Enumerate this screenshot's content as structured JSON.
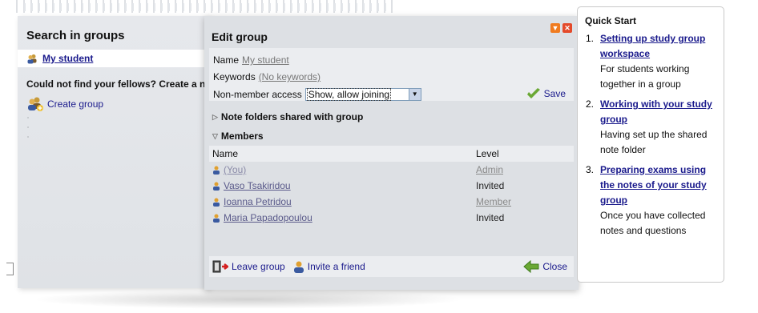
{
  "search_panel": {
    "title": "Search in groups",
    "my_group": "My student",
    "could_not_find": "Could not find your fellows? Create a n",
    "create_group": "Create group"
  },
  "edit_group": {
    "title": "Edit group",
    "name_label": "Name",
    "name_value": "My student",
    "keywords_label": "Keywords",
    "keywords_value": "(No keywords)",
    "access_label": "Non-member access",
    "access_selected": "Show, allow joining",
    "save_label": "Save",
    "notes_section": "Note folders shared with group",
    "members_section": "Members",
    "members_header": {
      "name": "Name",
      "level": "Level"
    },
    "members": [
      {
        "name": "(You)",
        "level": "Admin"
      },
      {
        "name": "Vaso Tsakiridou",
        "level": "Invited"
      },
      {
        "name": "Ioanna Petridou",
        "level": "Member"
      },
      {
        "name": "Maria Papadopoulou",
        "level": "Invited"
      }
    ],
    "leave_group": "Leave group",
    "invite_friend": "Invite a friend",
    "close_label": "Close"
  },
  "quick_start": {
    "title": "Quick Start",
    "items": [
      {
        "num": "1.",
        "link": "Setting up study group workspace",
        "desc": "For students working together in a group"
      },
      {
        "num": "2.",
        "link": "Working with your study group",
        "desc": "Having set up the shared note folder"
      },
      {
        "num": "3.",
        "link": "Preparing exams using the notes of your study group",
        "desc": "Once you have collected notes and questions"
      }
    ]
  },
  "colors": {
    "link": "#1a1a8c",
    "panel_bg": "#dde0e4",
    "accent_orange": "#f07b1f",
    "close_red": "#e44a2a",
    "save_green": "#6aa834"
  }
}
